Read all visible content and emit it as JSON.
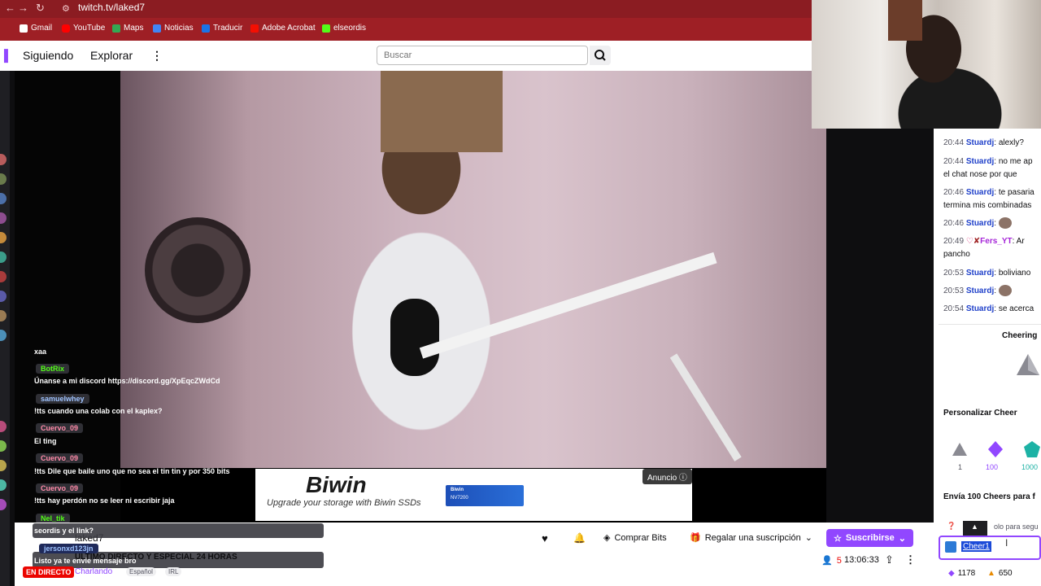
{
  "browser": {
    "url": "twitch.tv/laked7",
    "bookmarks": [
      "Gmail",
      "YouTube",
      "Maps",
      "Noticias",
      "Traducir",
      "Adobe Acrobat",
      "elseordis"
    ]
  },
  "twitch_nav": {
    "following": "Siguiendo",
    "browse": "Explorar",
    "more": "⋮",
    "search_placeholder": "Buscar"
  },
  "video_chat_overlay": [
    {
      "user": "",
      "text": "xaa"
    },
    {
      "user": "BotRix",
      "text": "Únanse a mi discord https://discord.gg/XpEqcZWdCd"
    },
    {
      "user": "samuelwhey",
      "text": "!tts cuando una colab con el kaplex?"
    },
    {
      "user": "Cuervo_09",
      "text": "El ting"
    },
    {
      "user": "Cuervo_09",
      "text": "!tts Dile que baile uno que no sea el tin tin y por 350 bits"
    },
    {
      "user": "Cuervo_09",
      "text": "!tts hay perdón no se leer ni escribir jaja"
    },
    {
      "user": "Nel_tik",
      "text": "seordis y el link?"
    },
    {
      "user": "jersonxd123jn",
      "text": "Listo ya te envie mensaje bro"
    }
  ],
  "ad": {
    "brand": "Biwin",
    "tagline": "Upgrade your storage with Biwin SSDs",
    "product": "NV7200",
    "label": "Anuncio"
  },
  "stream_info": {
    "channel": "laked7",
    "title": "ULTIMO DIRECTO Y ESPECIAL 24 HORAS",
    "live_badge": "EN DIRECTO",
    "category": "Charlando",
    "tags": [
      "Español",
      "IRL"
    ],
    "viewers": "5",
    "uptime": "13:06:33",
    "buy_bits": "Comprar Bits",
    "gift_sub": "Regalar una suscripción",
    "subscribe": "Suscribirse"
  },
  "right_chat": [
    {
      "time": "20:44",
      "user": "Stuardj",
      "text": "alexly?"
    },
    {
      "time": "20:44",
      "user": "Stuardj",
      "text": "no me ap",
      "text2": "el chat nose por que"
    },
    {
      "time": "20:46",
      "user": "Stuardj",
      "text": "te pasaria",
      "text2": "termina mis combinadas"
    },
    {
      "time": "20:46",
      "user": "Stuardj",
      "text": ""
    },
    {
      "time": "20:49",
      "user": "Fers_YT",
      "text": "Ar",
      "text2": "pancho"
    },
    {
      "time": "20:53",
      "user": "Stuardj",
      "text": "boliviano"
    },
    {
      "time": "20:53",
      "user": "Stuardj",
      "text": ""
    },
    {
      "time": "20:54",
      "user": "Stuardj",
      "text": "se acerca"
    }
  ],
  "cheer": {
    "title": "Cheering",
    "customize": "Personalizar Cheer",
    "amounts": [
      "1",
      "100",
      "1000"
    ],
    "send_text": "Envía 100 Cheers para f",
    "hint": "olo para segu",
    "input_word": "Cheer1",
    "bits_balance": "1178",
    "bits_other": "650"
  },
  "colors": {
    "twitch_purple": "#9147ff",
    "live_red": "#eb0400",
    "browser_red": "#9e1f25"
  }
}
